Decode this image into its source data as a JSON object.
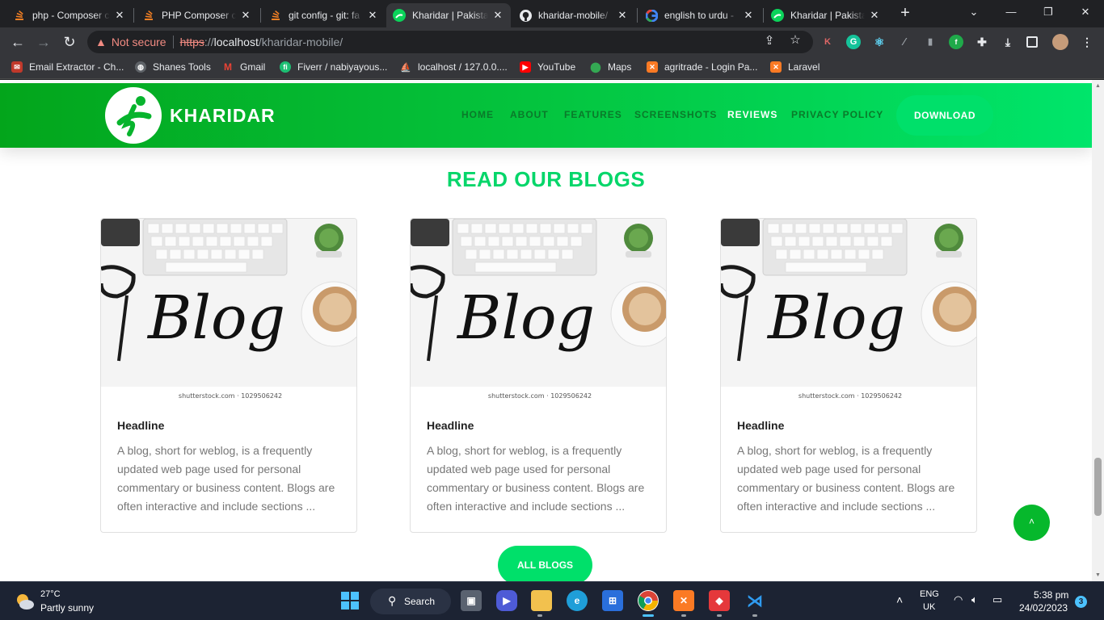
{
  "tabs": [
    {
      "title": "php - Composer c",
      "icon": "stackoverflow-icon"
    },
    {
      "title": "PHP Composer ca",
      "icon": "stackoverflow-icon"
    },
    {
      "title": "git config - git: fa",
      "icon": "stackoverflow-icon"
    },
    {
      "title": "Kharidar | Pakista",
      "icon": "kharidar-icon",
      "active": true
    },
    {
      "title": "kharidar-mobile/",
      "icon": "github-icon"
    },
    {
      "title": "english to urdu -",
      "icon": "google-icon"
    },
    {
      "title": "Kharidar | Pakista",
      "icon": "kharidar-icon"
    }
  ],
  "address": {
    "security": "Not secure",
    "protocol": "https",
    "rest_sep": "://",
    "host": "localhost",
    "path": "/kharidar-mobile/"
  },
  "extensions": [
    "K",
    "G"
  ],
  "bookmarks": [
    {
      "label": "Email Extractor - Ch...",
      "icon": "email-extractor-icon"
    },
    {
      "label": "Shanes Tools",
      "icon": "globe-icon"
    },
    {
      "label": "Gmail",
      "icon": "gmail-icon"
    },
    {
      "label": "Fiverr / nabiyayous...",
      "icon": "fiverr-icon"
    },
    {
      "label": "localhost / 127.0.0....",
      "icon": "phpmyadmin-icon"
    },
    {
      "label": "YouTube",
      "icon": "youtube-icon"
    },
    {
      "label": "Maps",
      "icon": "maps-icon"
    },
    {
      "label": "agritrade - Login Pa...",
      "icon": "xampp-icon"
    },
    {
      "label": "Laravel",
      "icon": "xampp-icon"
    }
  ],
  "site": {
    "brand": "KHARIDAR",
    "nav": [
      "HOME",
      "ABOUT",
      "FEATURES",
      "SCREENSHOTS",
      "REVIEWS",
      "PRIVACY POLICY"
    ],
    "active_nav": "REVIEWS",
    "download": "DOWNLOAD",
    "section_title": "READ OUR BLOGS",
    "blog_image_word": "Blog",
    "blog_image_credit": "shutterstock.com · 1029506242",
    "cards": [
      {
        "headline": "Headline",
        "text": "A blog, short for weblog, is a frequently updated web page used for personal commentary or business content. Blogs are often interactive and include sections ..."
      },
      {
        "headline": "Headline",
        "text": "A blog, short for weblog, is a frequently updated web page used for personal commentary or business content. Blogs are often interactive and include sections ..."
      },
      {
        "headline": "Headline",
        "text": "A blog, short for weblog, is a frequently updated web page used for personal commentary or business content. Blogs are often interactive and include sections ..."
      }
    ],
    "all_blogs": "ALL BLOGS",
    "to_top": "˄"
  },
  "taskbar": {
    "temp": "27°C",
    "weather": "Partly sunny",
    "search": "Search",
    "lang1": "ENG",
    "lang2": "UK",
    "time": "5:38 pm",
    "date": "24/02/2023",
    "badge": "3"
  },
  "colors": {
    "brand_green": "#06d66a",
    "header_start": "#03a51b",
    "header_end": "#00e56b"
  }
}
